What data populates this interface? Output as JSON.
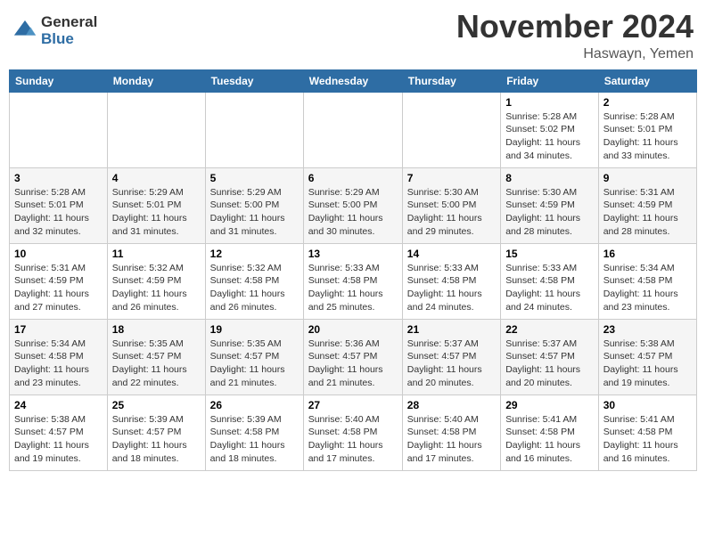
{
  "logo": {
    "general": "General",
    "blue": "Blue"
  },
  "title": "November 2024",
  "location": "Haswayn, Yemen",
  "weekdays": [
    "Sunday",
    "Monday",
    "Tuesday",
    "Wednesday",
    "Thursday",
    "Friday",
    "Saturday"
  ],
  "weeks": [
    [
      {
        "day": "",
        "info": ""
      },
      {
        "day": "",
        "info": ""
      },
      {
        "day": "",
        "info": ""
      },
      {
        "day": "",
        "info": ""
      },
      {
        "day": "",
        "info": ""
      },
      {
        "day": "1",
        "info": "Sunrise: 5:28 AM\nSunset: 5:02 PM\nDaylight: 11 hours and 34 minutes."
      },
      {
        "day": "2",
        "info": "Sunrise: 5:28 AM\nSunset: 5:01 PM\nDaylight: 11 hours and 33 minutes."
      }
    ],
    [
      {
        "day": "3",
        "info": "Sunrise: 5:28 AM\nSunset: 5:01 PM\nDaylight: 11 hours and 32 minutes."
      },
      {
        "day": "4",
        "info": "Sunrise: 5:29 AM\nSunset: 5:01 PM\nDaylight: 11 hours and 31 minutes."
      },
      {
        "day": "5",
        "info": "Sunrise: 5:29 AM\nSunset: 5:00 PM\nDaylight: 11 hours and 31 minutes."
      },
      {
        "day": "6",
        "info": "Sunrise: 5:29 AM\nSunset: 5:00 PM\nDaylight: 11 hours and 30 minutes."
      },
      {
        "day": "7",
        "info": "Sunrise: 5:30 AM\nSunset: 5:00 PM\nDaylight: 11 hours and 29 minutes."
      },
      {
        "day": "8",
        "info": "Sunrise: 5:30 AM\nSunset: 4:59 PM\nDaylight: 11 hours and 28 minutes."
      },
      {
        "day": "9",
        "info": "Sunrise: 5:31 AM\nSunset: 4:59 PM\nDaylight: 11 hours and 28 minutes."
      }
    ],
    [
      {
        "day": "10",
        "info": "Sunrise: 5:31 AM\nSunset: 4:59 PM\nDaylight: 11 hours and 27 minutes."
      },
      {
        "day": "11",
        "info": "Sunrise: 5:32 AM\nSunset: 4:59 PM\nDaylight: 11 hours and 26 minutes."
      },
      {
        "day": "12",
        "info": "Sunrise: 5:32 AM\nSunset: 4:58 PM\nDaylight: 11 hours and 26 minutes."
      },
      {
        "day": "13",
        "info": "Sunrise: 5:33 AM\nSunset: 4:58 PM\nDaylight: 11 hours and 25 minutes."
      },
      {
        "day": "14",
        "info": "Sunrise: 5:33 AM\nSunset: 4:58 PM\nDaylight: 11 hours and 24 minutes."
      },
      {
        "day": "15",
        "info": "Sunrise: 5:33 AM\nSunset: 4:58 PM\nDaylight: 11 hours and 24 minutes."
      },
      {
        "day": "16",
        "info": "Sunrise: 5:34 AM\nSunset: 4:58 PM\nDaylight: 11 hours and 23 minutes."
      }
    ],
    [
      {
        "day": "17",
        "info": "Sunrise: 5:34 AM\nSunset: 4:58 PM\nDaylight: 11 hours and 23 minutes."
      },
      {
        "day": "18",
        "info": "Sunrise: 5:35 AM\nSunset: 4:57 PM\nDaylight: 11 hours and 22 minutes."
      },
      {
        "day": "19",
        "info": "Sunrise: 5:35 AM\nSunset: 4:57 PM\nDaylight: 11 hours and 21 minutes."
      },
      {
        "day": "20",
        "info": "Sunrise: 5:36 AM\nSunset: 4:57 PM\nDaylight: 11 hours and 21 minutes."
      },
      {
        "day": "21",
        "info": "Sunrise: 5:37 AM\nSunset: 4:57 PM\nDaylight: 11 hours and 20 minutes."
      },
      {
        "day": "22",
        "info": "Sunrise: 5:37 AM\nSunset: 4:57 PM\nDaylight: 11 hours and 20 minutes."
      },
      {
        "day": "23",
        "info": "Sunrise: 5:38 AM\nSunset: 4:57 PM\nDaylight: 11 hours and 19 minutes."
      }
    ],
    [
      {
        "day": "24",
        "info": "Sunrise: 5:38 AM\nSunset: 4:57 PM\nDaylight: 11 hours and 19 minutes."
      },
      {
        "day": "25",
        "info": "Sunrise: 5:39 AM\nSunset: 4:57 PM\nDaylight: 11 hours and 18 minutes."
      },
      {
        "day": "26",
        "info": "Sunrise: 5:39 AM\nSunset: 4:58 PM\nDaylight: 11 hours and 18 minutes."
      },
      {
        "day": "27",
        "info": "Sunrise: 5:40 AM\nSunset: 4:58 PM\nDaylight: 11 hours and 17 minutes."
      },
      {
        "day": "28",
        "info": "Sunrise: 5:40 AM\nSunset: 4:58 PM\nDaylight: 11 hours and 17 minutes."
      },
      {
        "day": "29",
        "info": "Sunrise: 5:41 AM\nSunset: 4:58 PM\nDaylight: 11 hours and 16 minutes."
      },
      {
        "day": "30",
        "info": "Sunrise: 5:41 AM\nSunset: 4:58 PM\nDaylight: 11 hours and 16 minutes."
      }
    ]
  ]
}
